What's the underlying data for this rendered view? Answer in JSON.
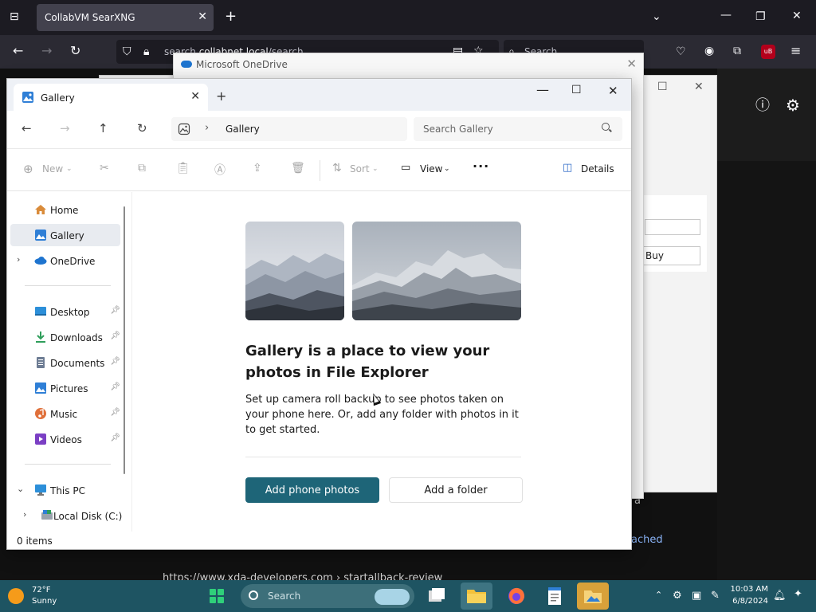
{
  "browser": {
    "tab_title": "CollabVM SearXNG",
    "url_prefix": "search.",
    "url_domain": "collabnet.local",
    "url_path": "/search",
    "search_placeholder": "Search"
  },
  "background": {
    "behind_button": "Buy",
    "stray_letter": "a",
    "link_text": "ached",
    "url_snippet": "https://www.xda-developers.com › startallback-review"
  },
  "onedrive": {
    "title": "Microsoft OneDrive"
  },
  "explorer": {
    "tab_label": "Gallery",
    "breadcrumb": "Gallery",
    "search_placeholder": "Search Gallery",
    "commands": {
      "new": "New",
      "sort": "Sort",
      "view": "View",
      "details": "Details"
    },
    "sidebar": {
      "home": "Home",
      "gallery": "Gallery",
      "onedrive": "OneDrive",
      "desktop": "Desktop",
      "downloads": "Downloads",
      "documents": "Documents",
      "pictures": "Pictures",
      "music": "Music",
      "videos": "Videos",
      "this_pc": "This PC",
      "local_disk": "Local Disk (C:)"
    },
    "main": {
      "title": "Gallery is a place to view your photos in File Explorer",
      "description": "Set up camera roll backup to see photos taken on your phone here. Or, add any folder with photos in it to get started.",
      "primary_button": "Add phone photos",
      "secondary_button": "Add a folder"
    },
    "status": "0 items"
  },
  "taskbar": {
    "temperature": "72°F",
    "condition": "Sunny",
    "search_placeholder": "Search",
    "time": "10:03 AM",
    "date": "6/8/2024"
  },
  "colors": {
    "accent": "#1e6578",
    "taskbar": "#1e5462",
    "browser_dark": "#1c1b22"
  }
}
